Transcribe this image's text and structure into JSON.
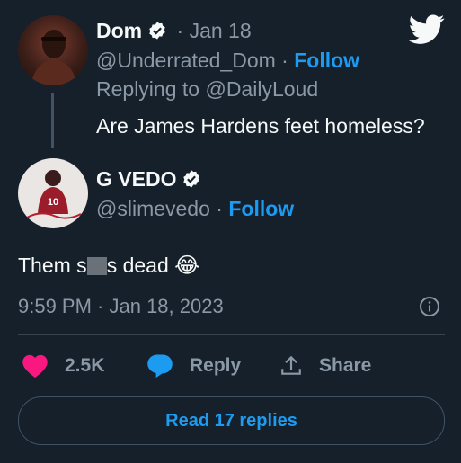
{
  "parent_tweet": {
    "display_name": "Dom",
    "date": "· Jan 18",
    "handle": "@Underrated_Dom",
    "separator": "·",
    "follow_label": "Follow",
    "replying_prefix": "Replying to",
    "replying_to": "@DailyLoud",
    "text": "Are James Hardens feet homeless?"
  },
  "reply_tweet": {
    "display_name": "G VEDO",
    "handle": "@slimevedo",
    "separator": "·",
    "follow_label": "Follow",
    "avatar_jersey_number": "10",
    "text_start": "Them s",
    "text_end": "s dead",
    "emoji": "😂",
    "timestamp": "9:59 PM · Jan 18, 2023"
  },
  "actions": {
    "like_count": "2.5K",
    "reply_label": "Reply",
    "share_label": "Share"
  },
  "read_replies_label": "Read 17 replies",
  "colors": {
    "background": "#15202b",
    "accent": "#1d9bf0",
    "like": "#f91880",
    "muted": "#8b98a5"
  },
  "icons": [
    "twitter-bird-icon",
    "verified-badge-icon",
    "info-icon",
    "heart-icon",
    "reply-bubble-icon",
    "share-icon"
  ]
}
